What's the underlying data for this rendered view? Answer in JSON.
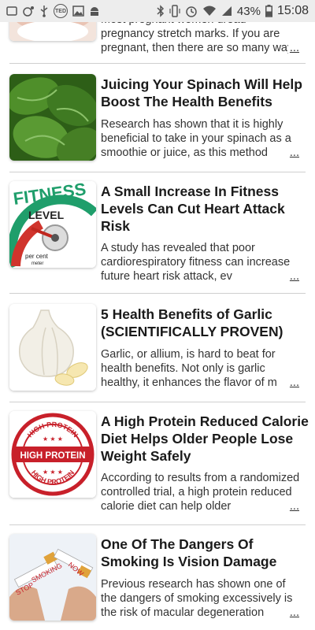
{
  "status_bar": {
    "battery_percent": "43%",
    "clock": "15:08",
    "notification_badge": "TED",
    "left_icons": [
      "blank-notification-icon",
      "settings-dots-icon",
      "usb-icon",
      "ted-icon",
      "image-icon",
      "android-icon"
    ],
    "right_icons": [
      "bluetooth-icon",
      "vibrate-icon",
      "alarm-icon",
      "wifi-icon",
      "signal-icon",
      "battery-icon"
    ]
  },
  "articles": [
    {
      "title": "",
      "summary": "Most pregnant women dread pregnancy stretch marks. If you are pregnant, then there are so many ways t",
      "more": "...",
      "image": "stretch-marks-thumbnail"
    },
    {
      "title": "Juicing Your Spinach Will Help Boost The Health Benefits",
      "summary": "Research has shown that it is highly beneficial to take in your spinach as a smoothie or juice, as this method",
      "more": "...",
      "image": "spinach-thumbnail"
    },
    {
      "title": "A Small Increase In Fitness Levels Can Cut Heart Attack Risk",
      "summary": "A study has revealed that poor cardiorespiratory fitness can increase future heart risk attack, ev",
      "more": "...",
      "image": "fitness-level-gauge-thumbnail",
      "image_text": {
        "fitness": "FITNESS",
        "level": "LEVEL",
        "per_cent": "per cent",
        "meter": "meter"
      }
    },
    {
      "title": "5 Health Benefits of Garlic (SCIENTIFICALLY PROVEN)",
      "summary": "Garlic, or allium, is hard to beat for health benefits. Not only is garlic healthy, it enhances the flavor of m",
      "more": "...",
      "image": "garlic-thumbnail"
    },
    {
      "title": "A High Protein Reduced Calorie Diet Helps Older People Lose Weight Safely",
      "summary": "According to results from a randomized controlled trial, a high protein reduced calorie diet can help older",
      "more": "...",
      "image": "high-protein-stamp-thumbnail",
      "image_text": {
        "center": "HIGH PROTEIN",
        "ring": "HIGH PROTEIN"
      }
    },
    {
      "title": "One Of The Dangers Of Smoking Is Vision Damage",
      "summary": "Previous research has shown one of the dangers of smoking excessively is the risk of macular degeneration",
      "more": "...",
      "image": "stop-smoking-thumbnail",
      "image_text": {
        "stop": "STOP",
        "smoking": "SMOKING",
        "now": "NOW"
      }
    }
  ],
  "colors": {
    "status_bar_bg": "#ededed",
    "divider": "#cfcfcf",
    "stamp_red": "#c8202a",
    "spinach_green": "#3f7a22"
  }
}
